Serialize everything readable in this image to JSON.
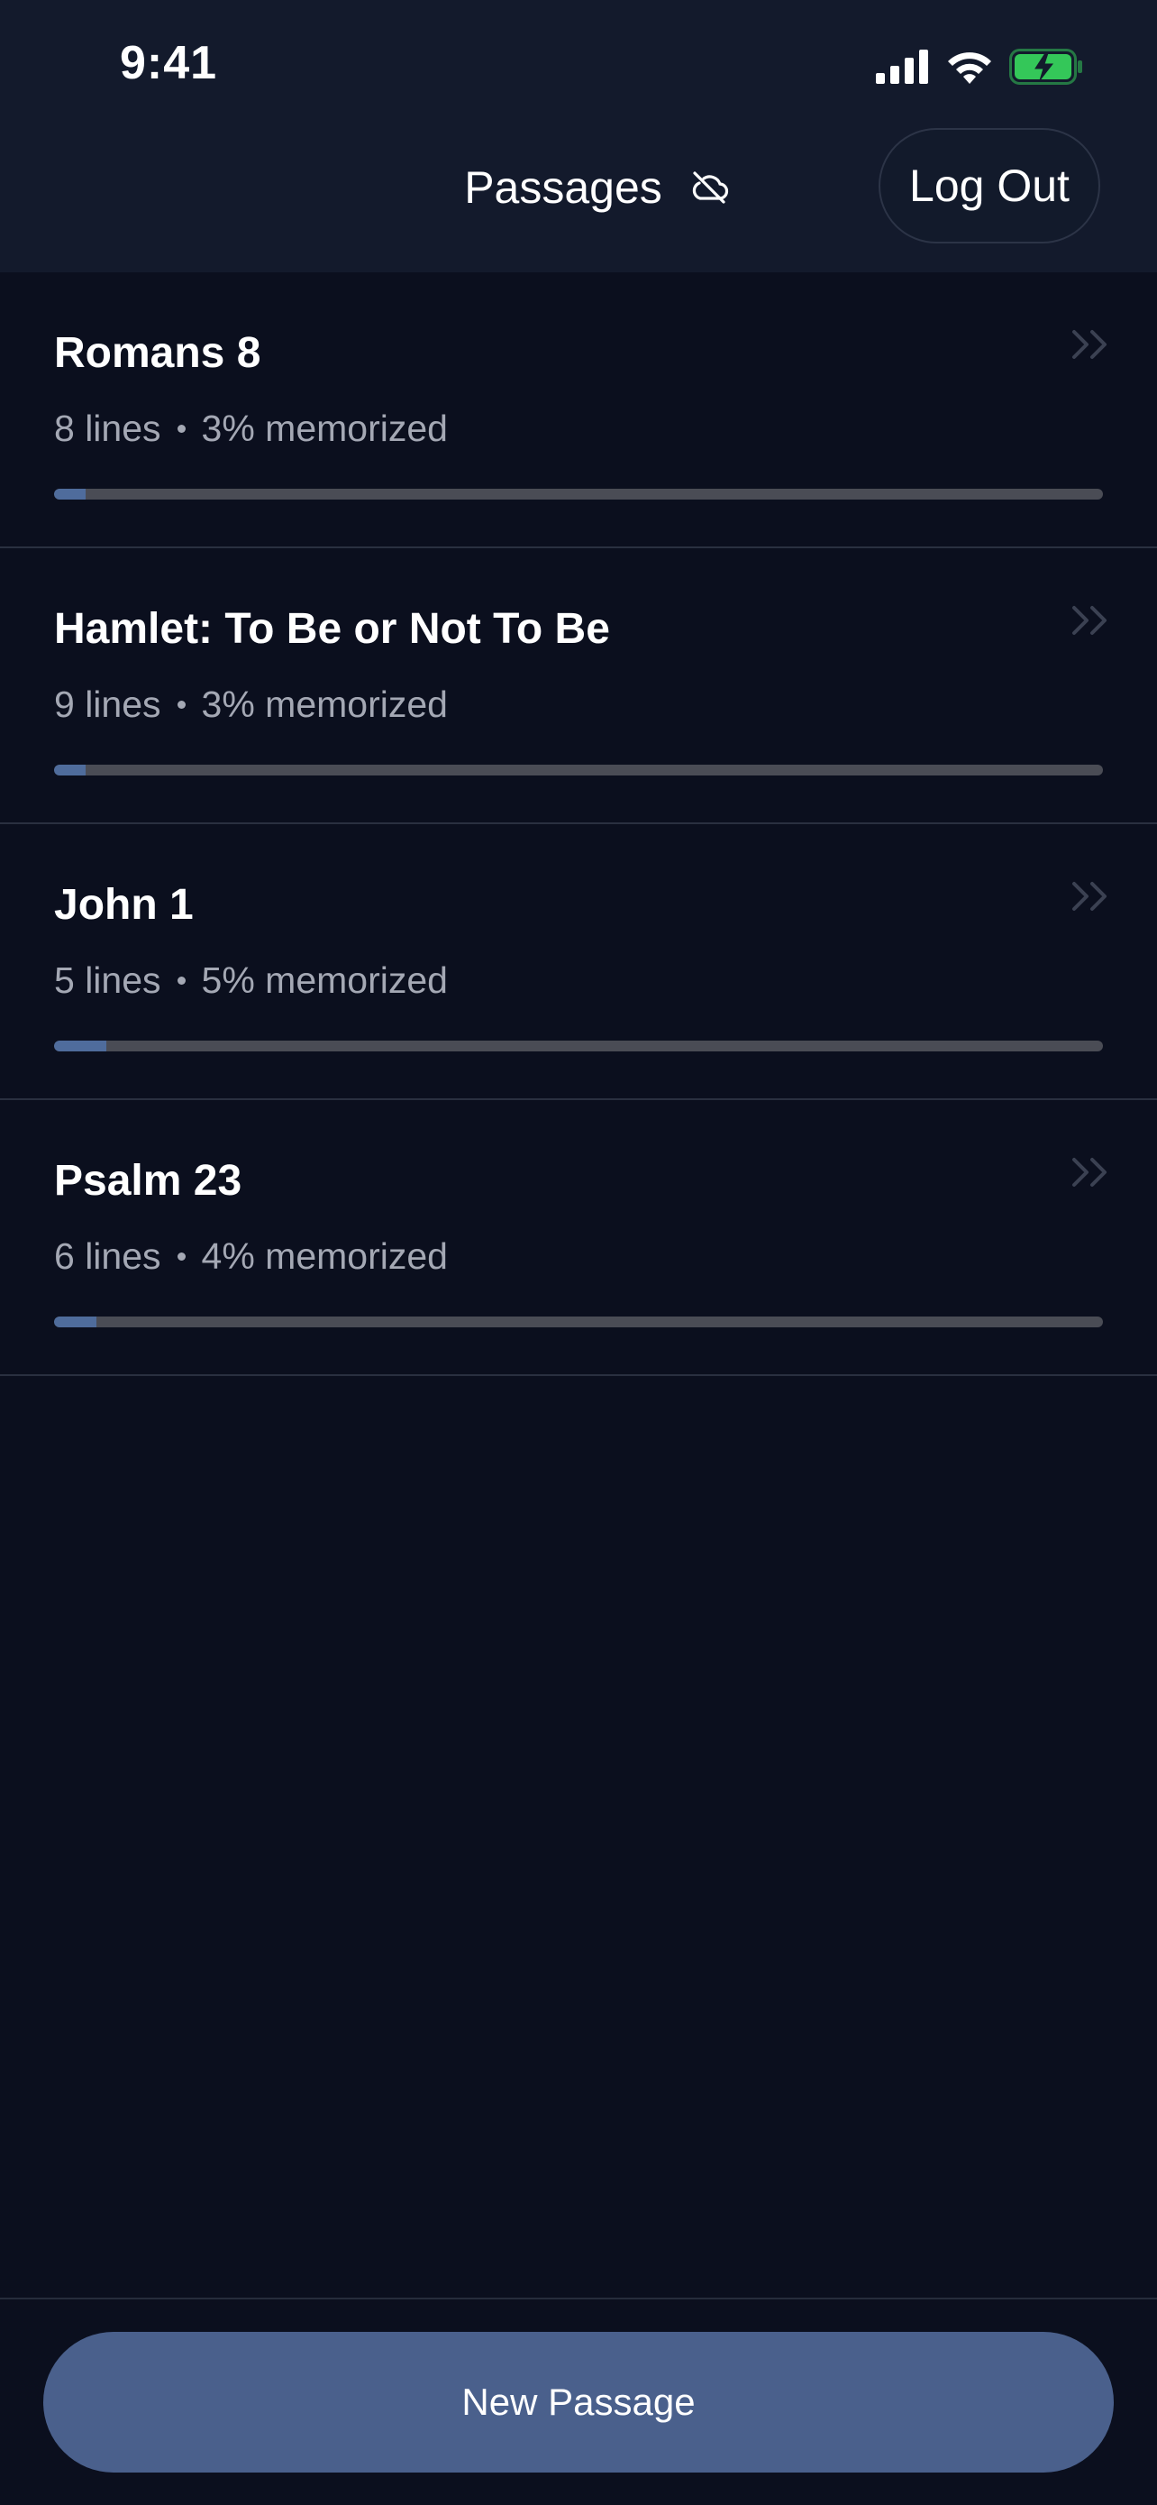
{
  "status_bar": {
    "time": "9:41",
    "icons": [
      "cellular-signal-icon",
      "wifi-icon",
      "battery-charging-icon"
    ]
  },
  "nav": {
    "title": "Passages",
    "sync_icon": "cloud-off-icon",
    "logout_label": "Log Out"
  },
  "passages": [
    {
      "title": "Romans 8",
      "lines": "8 lines",
      "memorized": "3% memorized",
      "progress": 0.03
    },
    {
      "title": "Hamlet: To Be or Not To Be",
      "lines": "9 lines",
      "memorized": "3% memorized",
      "progress": 0.03
    },
    {
      "title": "John 1",
      "lines": "5 lines",
      "memorized": "5% memorized",
      "progress": 0.05
    },
    {
      "title": "Psalm 23",
      "lines": "6 lines",
      "memorized": "4% memorized",
      "progress": 0.04
    }
  ],
  "footer": {
    "new_passage_label": "New Passage"
  },
  "colors": {
    "background": "#0b0f1e",
    "header": "#131a2c",
    "accent": "#4a608c",
    "progress_fill": "#4f6c9c",
    "progress_track": "#4a4c55",
    "battery": "#34c759"
  }
}
